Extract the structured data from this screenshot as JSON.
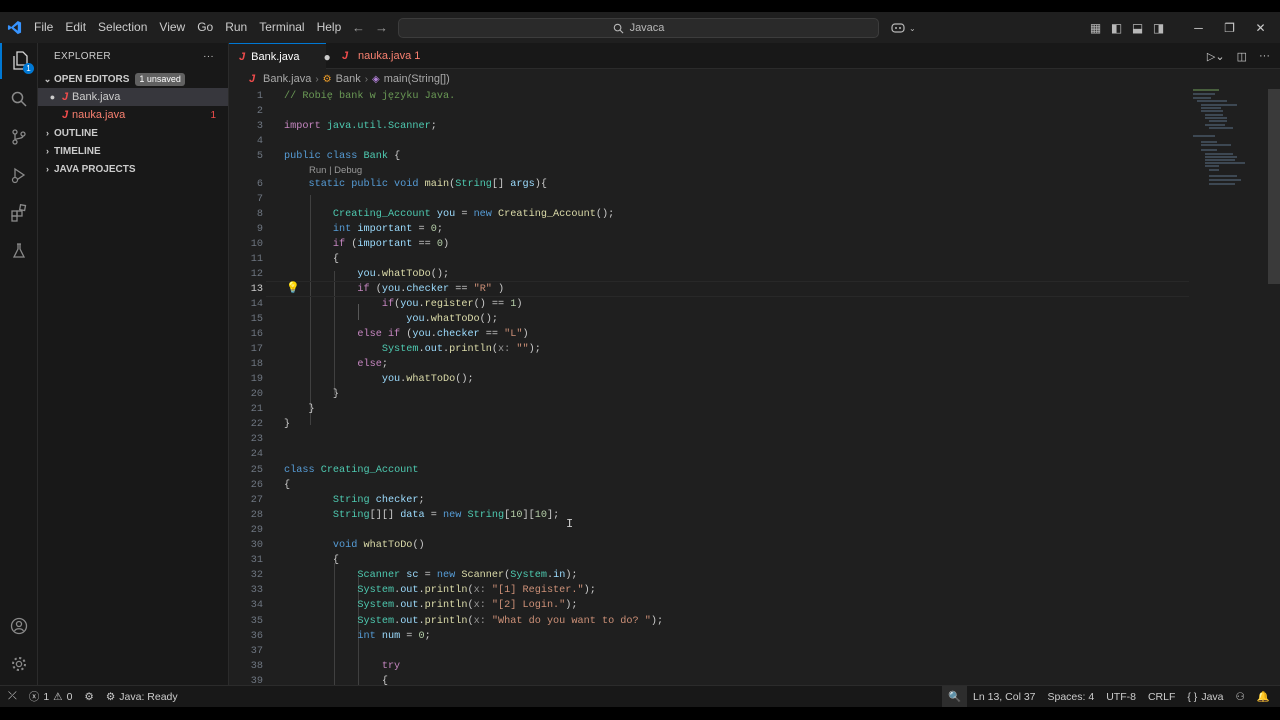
{
  "window": {
    "search_text": "Javaca"
  },
  "menu": [
    "File",
    "Edit",
    "Selection",
    "View",
    "Go",
    "Run",
    "Terminal",
    "Help"
  ],
  "sidebar": {
    "title": "EXPLORER",
    "more": "···",
    "open_editors": {
      "label": "OPEN EDITORS",
      "badge": "1 unsaved"
    },
    "files": [
      {
        "name": "Bank.java",
        "icon": "J",
        "modified": true
      },
      {
        "name": "nauka.java",
        "icon": "J",
        "errors": "1"
      }
    ],
    "sections": [
      "OUTLINE",
      "TIMELINE",
      "JAVA PROJECTS"
    ]
  },
  "tabs": [
    {
      "label": "Bank.java",
      "icon": "J",
      "status": "●"
    },
    {
      "label": "nauka.java 1",
      "icon": "J"
    }
  ],
  "breadcrumb": [
    "Bank.java",
    "Bank",
    "main(String[])"
  ],
  "editor": {
    "codelens": "Run | Debug",
    "current_line": 13
  },
  "statusbar": {
    "errors": "1",
    "warnings": "0",
    "java_status": "Java: Ready",
    "position": "Ln 13, Col 37",
    "spaces": "Spaces: 4",
    "encoding": "UTF-8",
    "eol": "CRLF",
    "language": "Java"
  },
  "colors": {
    "accent": "#0078d4",
    "error": "#f14c4c",
    "background": "#1f1f1f"
  }
}
